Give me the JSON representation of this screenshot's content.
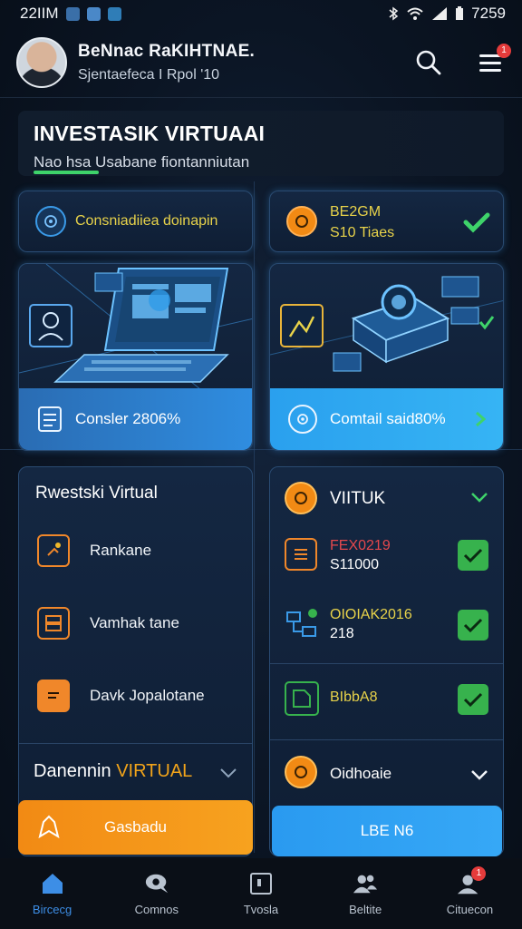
{
  "status_bar": {
    "time_left": "22IIM",
    "time_right": "7259"
  },
  "header": {
    "user_name": "BeNnac RaKIHTNAE.",
    "user_subtitle": "Sjentaefeca I Rpol '10",
    "notification_badge": "1"
  },
  "banner": {
    "title": "INVESTASIK VIRTUAAI",
    "subtitle": "Nao hsa Usabane fiontanniutan"
  },
  "pill_left": {
    "label": "Consniadiiea doinapin"
  },
  "pill_right": {
    "line1": "BE2GM",
    "line2": "S10 Tiaes"
  },
  "card_left": {
    "action_label": "Consler 2806%"
  },
  "card_right": {
    "action_label": "Comtail said80%"
  },
  "list_left": {
    "title": "Rwestski Virtual",
    "items": [
      {
        "label": "Rankane",
        "icon": "clipboard-icon"
      },
      {
        "label": "Vamhak tane",
        "icon": "stack-icon"
      },
      {
        "label": "Davk Jopalotane",
        "icon": "chat-icon"
      }
    ],
    "footer_prefix": "Danennin ",
    "footer_highlight": "VIRTUAL",
    "button_label": "Gasbadu"
  },
  "list_right": {
    "title": "VIITUK",
    "items": [
      {
        "line1": "FEX0219",
        "line2": "S11000",
        "line1_color": "#e5484d",
        "icon": "document-icon"
      },
      {
        "line1": "OIOIAK2016",
        "line2": "218",
        "line1_color": "#e8d34a",
        "icon": "flowchart-icon"
      },
      {
        "line1": "BIbbA8",
        "line2": "",
        "line1_color": "#e8d34a",
        "icon": "tag-icon"
      }
    ],
    "footer_label": "Oidhoaie",
    "button_label": "LBE N6"
  },
  "tabs": [
    {
      "label": "Bircecg",
      "icon": "home-icon",
      "active": true
    },
    {
      "label": "Comnos",
      "icon": "chat-bubble-icon",
      "active": false
    },
    {
      "label": "Tvosla",
      "icon": "square-icon",
      "active": false
    },
    {
      "label": "Beltite",
      "icon": "users-icon",
      "active": false
    },
    {
      "label": "Cituecon",
      "icon": "account-icon",
      "active": false,
      "badge": "1"
    }
  ],
  "colors": {
    "accent_blue": "#2f9be8",
    "accent_orange": "#f28a14",
    "accent_green": "#37b24d",
    "background": "#0b1524"
  }
}
